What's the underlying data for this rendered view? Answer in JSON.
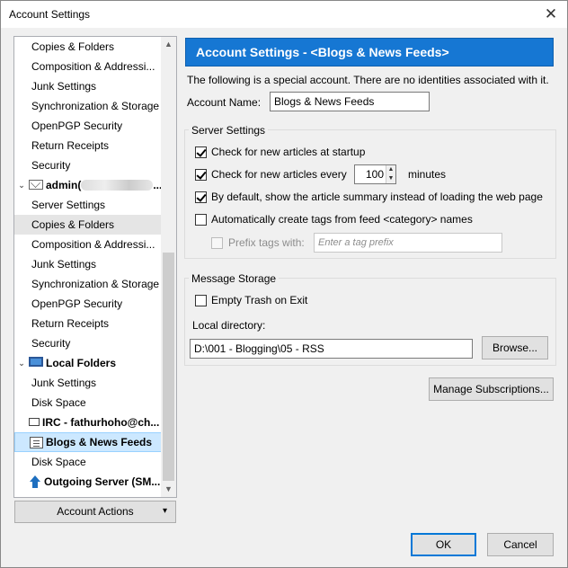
{
  "window": {
    "title": "Account Settings",
    "close_glyph": "✕"
  },
  "tree": {
    "items": [
      {
        "label": "Copies & Folders",
        "kind": "child"
      },
      {
        "label": "Composition & Addressi...",
        "kind": "child"
      },
      {
        "label": "Junk Settings",
        "kind": "child"
      },
      {
        "label": "Synchronization & Storage",
        "kind": "child"
      },
      {
        "label": "OpenPGP Security",
        "kind": "child"
      },
      {
        "label": "Return Receipts",
        "kind": "child"
      },
      {
        "label": "Security",
        "kind": "child"
      },
      {
        "label": "admin(",
        "suffix": "...",
        "kind": "account",
        "icon": "mail-account-icon"
      },
      {
        "label": "Server Settings",
        "kind": "child"
      },
      {
        "label": "Copies & Folders",
        "kind": "child"
      },
      {
        "label": "Composition & Addressi...",
        "kind": "child"
      },
      {
        "label": "Junk Settings",
        "kind": "child"
      },
      {
        "label": "Synchronization & Storage",
        "kind": "child"
      },
      {
        "label": "OpenPGP Security",
        "kind": "child"
      },
      {
        "label": "Return Receipts",
        "kind": "child"
      },
      {
        "label": "Security",
        "kind": "child"
      },
      {
        "label": "Local Folders",
        "kind": "account",
        "icon": "computer-icon"
      },
      {
        "label": "Junk Settings",
        "kind": "child"
      },
      {
        "label": "Disk Space",
        "kind": "child"
      },
      {
        "label": "IRC - fathurhoho@ch...",
        "kind": "account",
        "icon": "chat-icon"
      },
      {
        "label": "Blogs & News Feeds",
        "kind": "account",
        "icon": "rss-feed-icon"
      },
      {
        "label": "Disk Space",
        "kind": "child"
      },
      {
        "label": "Outgoing Server (SM...",
        "kind": "account",
        "icon": "outgoing-server-icon"
      }
    ],
    "account_actions_label": "Account Actions",
    "account_actions_arrow": "▾"
  },
  "panel": {
    "header": "Account Settings - <Blogs & News Feeds>",
    "note": "The following is a special account. There are no identities associated with it.",
    "account_name_label": "Account Name:",
    "account_name_value": "Blogs & News Feeds",
    "server_settings": {
      "legend": "Server Settings",
      "check_startup": {
        "label": "Check for new articles at startup",
        "checked": true
      },
      "check_every": {
        "label": "Check for new articles every",
        "value": "100",
        "unit": "minutes",
        "checked": true
      },
      "show_summary": {
        "label": "By default, show the article summary instead of loading the web page",
        "checked": true
      },
      "auto_tags": {
        "label": "Automatically create tags from feed <category> names",
        "checked": false
      },
      "prefix_tags": {
        "label": "Prefix tags with:",
        "placeholder": "Enter a tag prefix",
        "checked": false,
        "disabled": true
      }
    },
    "message_storage": {
      "legend": "Message Storage",
      "empty_trash": {
        "label": "Empty Trash on Exit",
        "checked": false
      },
      "local_directory_label": "Local directory:",
      "local_directory_value": "D:\\001 - Blogging\\05 - RSS",
      "browse_label": "Browse..."
    },
    "manage_subscriptions_label": "Manage Subscriptions..."
  },
  "footer": {
    "ok_label": "OK",
    "cancel_label": "Cancel"
  }
}
